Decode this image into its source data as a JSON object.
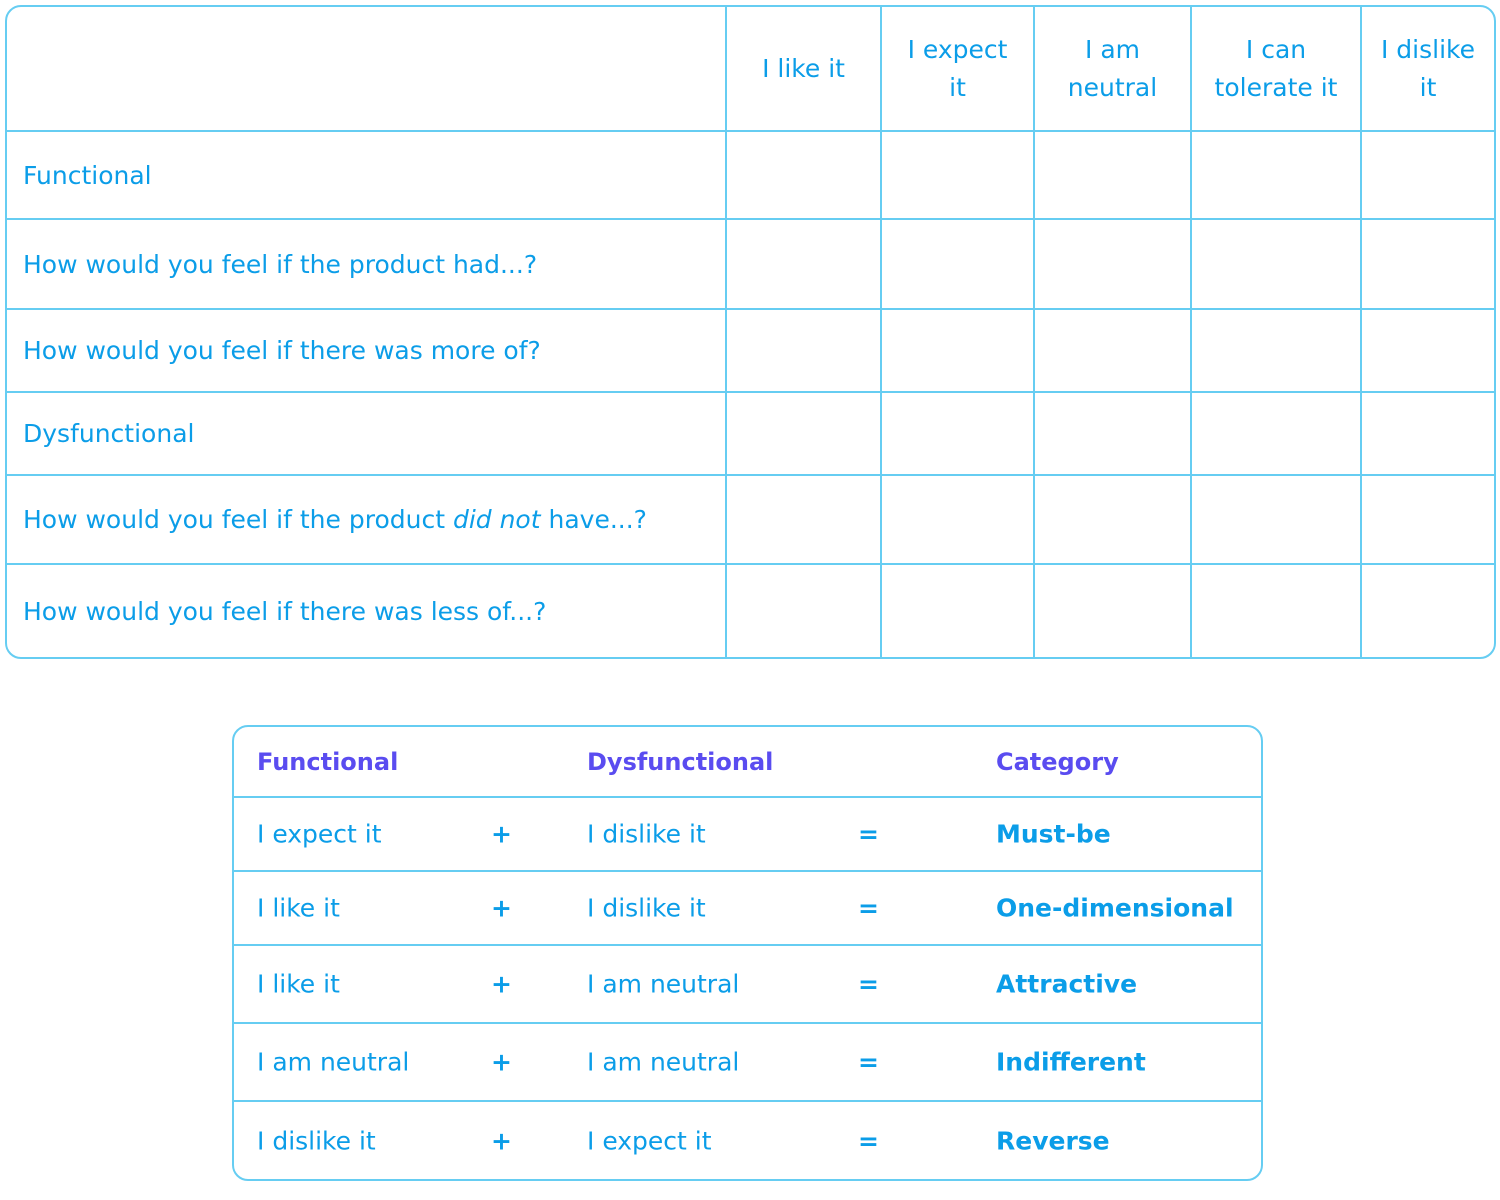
{
  "survey_table": {
    "columns": [
      "I like it",
      "I expect it",
      "I am neutral",
      "I can tolerate it",
      "I dislike it"
    ],
    "column_lines": [
      [
        "I like it"
      ],
      [
        "I expect",
        "it"
      ],
      [
        "I am",
        "neutral"
      ],
      [
        "I can",
        "tolerate it"
      ],
      [
        "I dislike",
        "it"
      ]
    ],
    "rows": [
      {
        "label": "Functional"
      },
      {
        "label": "How would you feel if the product had...?"
      },
      {
        "label": "How would you feel if there was more of?"
      },
      {
        "label": "Dysfunctional"
      },
      {
        "label_before": "How would you feel if the product ",
        "label_emphasis": "did not",
        "label_after": " have...?"
      },
      {
        "label": "How would you feel if there was less of...?"
      }
    ]
  },
  "category_table": {
    "headers": {
      "functional": "Functional",
      "dysfunctional": "Dysfunctional",
      "category": "Category"
    },
    "plus_symbol": "+",
    "equals_symbol": "=",
    "rows": [
      {
        "functional": "I expect it",
        "dysfunctional": "I dislike it",
        "category": "Must-be"
      },
      {
        "functional": "I like it",
        "dysfunctional": "I dislike it",
        "category": "One-dimensional"
      },
      {
        "functional": "I like it",
        "dysfunctional": "I am neutral",
        "category": "Attractive"
      },
      {
        "functional": "I am neutral",
        "dysfunctional": "I am neutral",
        "category": "Indifferent"
      },
      {
        "functional": "I dislike it",
        "dysfunctional": "I expect it",
        "category": "Reverse"
      }
    ]
  },
  "colors": {
    "text": "#0b9de8",
    "header_accent": "#5a4cf0",
    "border": "#66cdf2"
  }
}
